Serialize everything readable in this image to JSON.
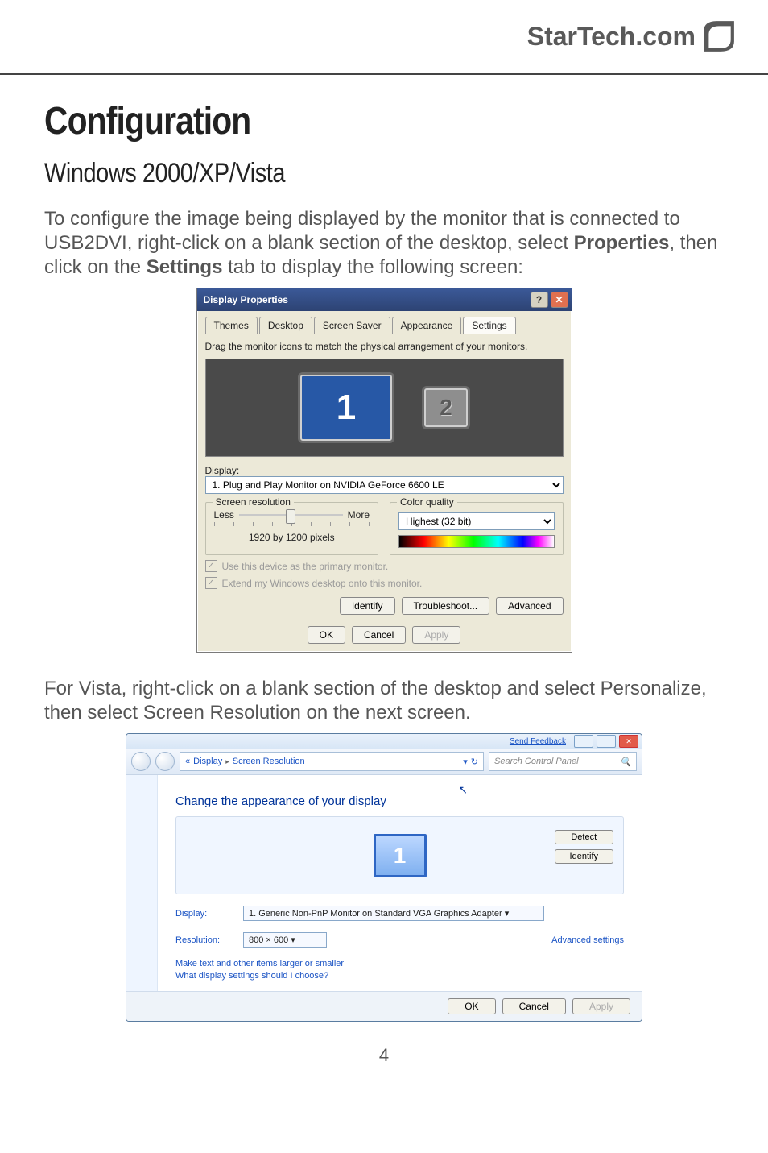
{
  "header": {
    "brand": "StarTech.com"
  },
  "h1": "Configuration",
  "h2": "Windows 2000/XP/Vista",
  "p1_pre": "To configure the image being displayed by the monitor that is connected to USB2DVI, right-click on a blank section of the desktop, select ",
  "p1_b1": "Properties",
  "p1_mid": ", then click on the ",
  "p1_b2": "Settings",
  "p1_post": " tab to display the following screen:",
  "p2": "For Vista, right-click on a blank section of the desktop and select Personalize, then select Screen Resolution on the next screen.",
  "page_number": "4",
  "dlg1": {
    "title": "Display Properties",
    "help_btn": "?",
    "close_btn": "✕",
    "tabs": [
      "Themes",
      "Desktop",
      "Screen Saver",
      "Appearance",
      "Settings"
    ],
    "active_tab_index": 4,
    "instruction": "Drag the monitor icons to match the physical arrangement of your monitors.",
    "mon1": "1",
    "mon2": "2",
    "display_label": "Display:",
    "display_value": "1. Plug and Play Monitor on NVIDIA GeForce 6600 LE",
    "res_group": "Screen resolution",
    "res_less": "Less",
    "res_more": "More",
    "res_text": "1920 by 1200 pixels",
    "color_group": "Color quality",
    "color_value": "Highest (32 bit)",
    "chk1": "Use this device as the primary monitor.",
    "chk2": "Extend my Windows desktop onto this monitor.",
    "btn_identify": "Identify",
    "btn_trouble": "Troubleshoot...",
    "btn_adv": "Advanced",
    "btn_ok": "OK",
    "btn_cancel": "Cancel",
    "btn_apply": "Apply"
  },
  "dlg2": {
    "feedback": "Send Feedback",
    "close_x": "✕",
    "crumb_pre": "«",
    "crumb1": "Display",
    "crumb_sep": "▸",
    "crumb2": "Screen Resolution",
    "refresh": "↻",
    "search_placeholder": "Search Control Panel",
    "search_icon": "🔍",
    "cursor": "↖",
    "heading": "Change the appearance of your display",
    "mon_label": "1",
    "btn_detect": "Detect",
    "btn_identify": "Identify",
    "display_label": "Display:",
    "display_value": "1. Generic Non-PnP Monitor on Standard VGA Graphics Adapter ▾",
    "res_label": "Resolution:",
    "res_value": "800 × 600   ▾",
    "adv_link": "Advanced settings",
    "help_link1": "Make text and other items larger or smaller",
    "help_link2": "What display settings should I choose?",
    "btn_ok": "OK",
    "btn_cancel": "Cancel",
    "btn_apply": "Apply"
  }
}
